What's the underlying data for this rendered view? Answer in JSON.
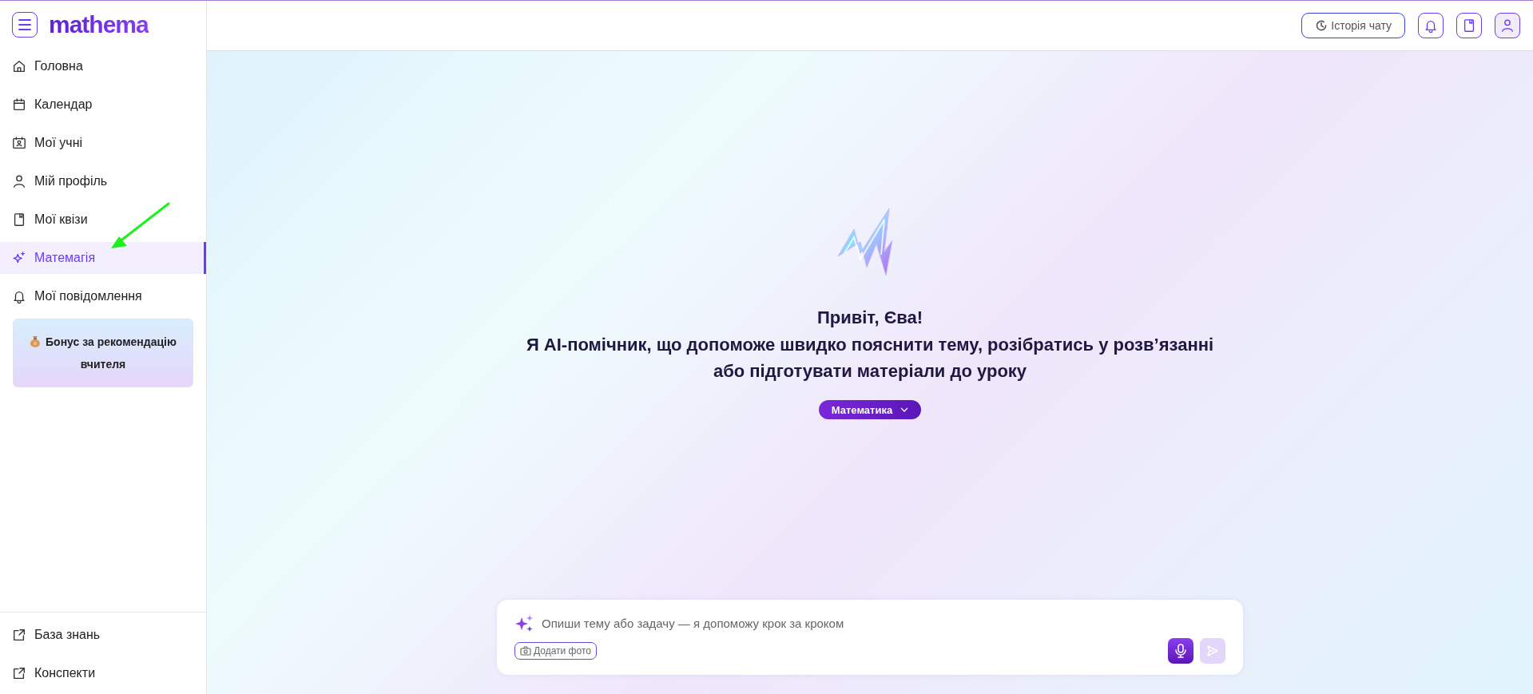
{
  "sidebar": {
    "logo": "mathema",
    "items": [
      {
        "label": "Головна",
        "kind": "home",
        "selected": false
      },
      {
        "label": "Календар",
        "kind": "calendar",
        "selected": false
      },
      {
        "label": "Мої учні",
        "kind": "students",
        "selected": false
      },
      {
        "label": "Мій профіль",
        "kind": "profile",
        "selected": false
      },
      {
        "label": "Мої квізи",
        "kind": "quiz",
        "selected": false
      },
      {
        "label": "Матемагія",
        "kind": "sparkle",
        "selected": true
      },
      {
        "label": "Мої повідомлення",
        "kind": "bell",
        "selected": false
      }
    ],
    "bonus": "Бонус за рекомендацію вчителя",
    "footer_items": [
      {
        "label": "База знань"
      },
      {
        "label": "Конспекти"
      }
    ]
  },
  "header": {
    "history_button": "Історія чату"
  },
  "main": {
    "greeting": "Привіт, Єва!",
    "intro": "Я AI-помічник, що допоможе швидко пояснити тему, розібратись у розв’язанні або підготувати матеріали до уроку",
    "subject": "Математика",
    "input": {
      "placeholder": "Опиши тему або задачу — я допоможу крок за кроком",
      "add_photo": "Додати фото"
    }
  }
}
